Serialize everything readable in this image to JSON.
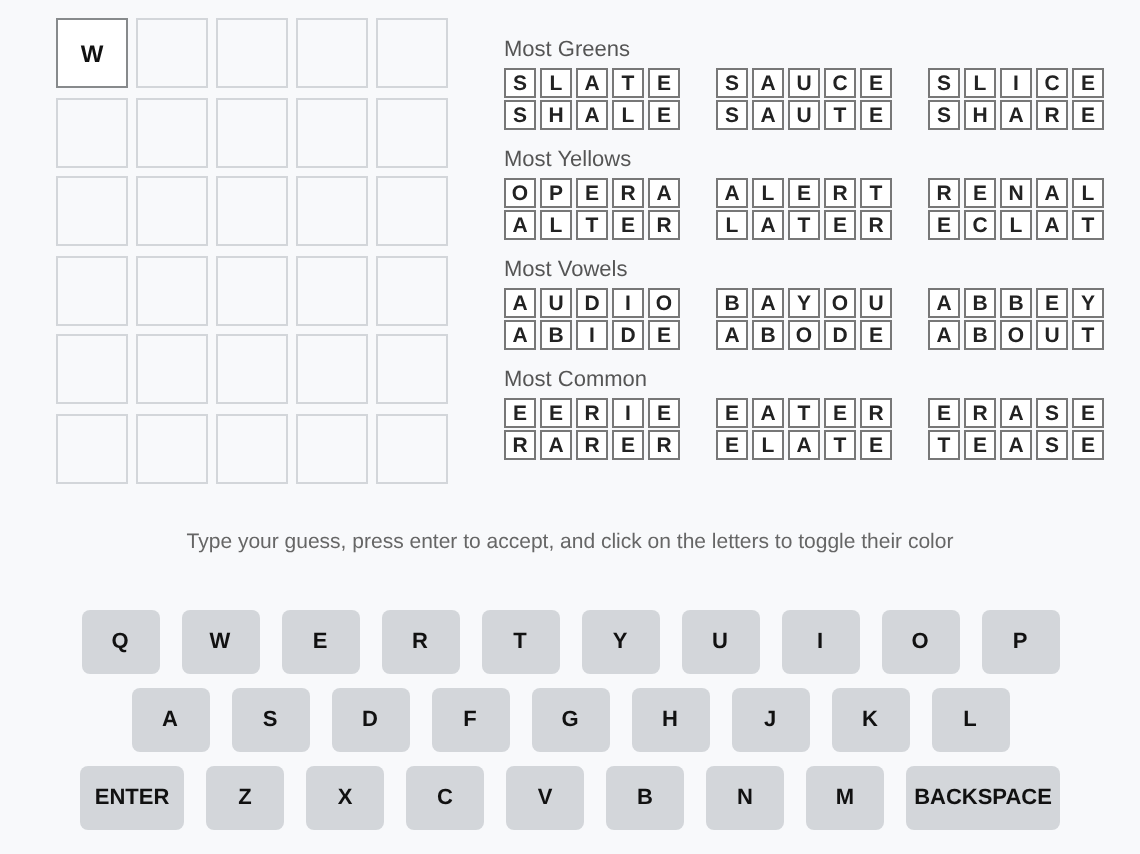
{
  "board": {
    "current_guess": [
      "W"
    ]
  },
  "suggestions": [
    {
      "title": "Most Greens",
      "words": [
        [
          "S",
          "L",
          "A",
          "T",
          "E"
        ],
        [
          "S",
          "A",
          "U",
          "C",
          "E"
        ],
        [
          "S",
          "L",
          "I",
          "C",
          "E"
        ],
        [
          "S",
          "H",
          "A",
          "L",
          "E"
        ],
        [
          "S",
          "A",
          "U",
          "T",
          "E"
        ],
        [
          "S",
          "H",
          "A",
          "R",
          "E"
        ]
      ]
    },
    {
      "title": "Most Yellows",
      "words": [
        [
          "O",
          "P",
          "E",
          "R",
          "A"
        ],
        [
          "A",
          "L",
          "E",
          "R",
          "T"
        ],
        [
          "R",
          "E",
          "N",
          "A",
          "L"
        ],
        [
          "A",
          "L",
          "T",
          "E",
          "R"
        ],
        [
          "L",
          "A",
          "T",
          "E",
          "R"
        ],
        [
          "E",
          "C",
          "L",
          "A",
          "T"
        ]
      ]
    },
    {
      "title": "Most Vowels",
      "words": [
        [
          "A",
          "U",
          "D",
          "I",
          "O"
        ],
        [
          "B",
          "A",
          "Y",
          "O",
          "U"
        ],
        [
          "A",
          "B",
          "B",
          "E",
          "Y"
        ],
        [
          "A",
          "B",
          "I",
          "D",
          "E"
        ],
        [
          "A",
          "B",
          "O",
          "D",
          "E"
        ],
        [
          "A",
          "B",
          "O",
          "U",
          "T"
        ]
      ]
    },
    {
      "title": "Most Common",
      "words": [
        [
          "E",
          "E",
          "R",
          "I",
          "E"
        ],
        [
          "E",
          "A",
          "T",
          "E",
          "R"
        ],
        [
          "E",
          "R",
          "A",
          "S",
          "E"
        ],
        [
          "R",
          "A",
          "R",
          "E",
          "R"
        ],
        [
          "E",
          "L",
          "A",
          "T",
          "E"
        ],
        [
          "T",
          "E",
          "A",
          "S",
          "E"
        ]
      ]
    }
  ],
  "instructions": "Type your guess, press enter to accept, and click on the letters to toggle their color",
  "keyboard": [
    [
      {
        "label": "Q",
        "kind": "letter"
      },
      {
        "label": "W",
        "kind": "letter"
      },
      {
        "label": "E",
        "kind": "letter"
      },
      {
        "label": "R",
        "kind": "letter"
      },
      {
        "label": "T",
        "kind": "letter"
      },
      {
        "label": "Y",
        "kind": "letter"
      },
      {
        "label": "U",
        "kind": "letter"
      },
      {
        "label": "I",
        "kind": "letter"
      },
      {
        "label": "O",
        "kind": "letter"
      },
      {
        "label": "P",
        "kind": "letter"
      }
    ],
    [
      {
        "label": "A",
        "kind": "letter"
      },
      {
        "label": "S",
        "kind": "letter"
      },
      {
        "label": "D",
        "kind": "letter"
      },
      {
        "label": "F",
        "kind": "letter"
      },
      {
        "label": "G",
        "kind": "letter"
      },
      {
        "label": "H",
        "kind": "letter"
      },
      {
        "label": "J",
        "kind": "letter"
      },
      {
        "label": "K",
        "kind": "letter"
      },
      {
        "label": "L",
        "kind": "letter"
      }
    ],
    [
      {
        "label": "ENTER",
        "kind": "wide"
      },
      {
        "label": "Z",
        "kind": "letter"
      },
      {
        "label": "X",
        "kind": "letter"
      },
      {
        "label": "C",
        "kind": "letter"
      },
      {
        "label": "V",
        "kind": "letter"
      },
      {
        "label": "B",
        "kind": "letter"
      },
      {
        "label": "N",
        "kind": "letter"
      },
      {
        "label": "M",
        "kind": "letter"
      },
      {
        "label": "BACKSPACE",
        "kind": "extra-wide"
      }
    ]
  ]
}
